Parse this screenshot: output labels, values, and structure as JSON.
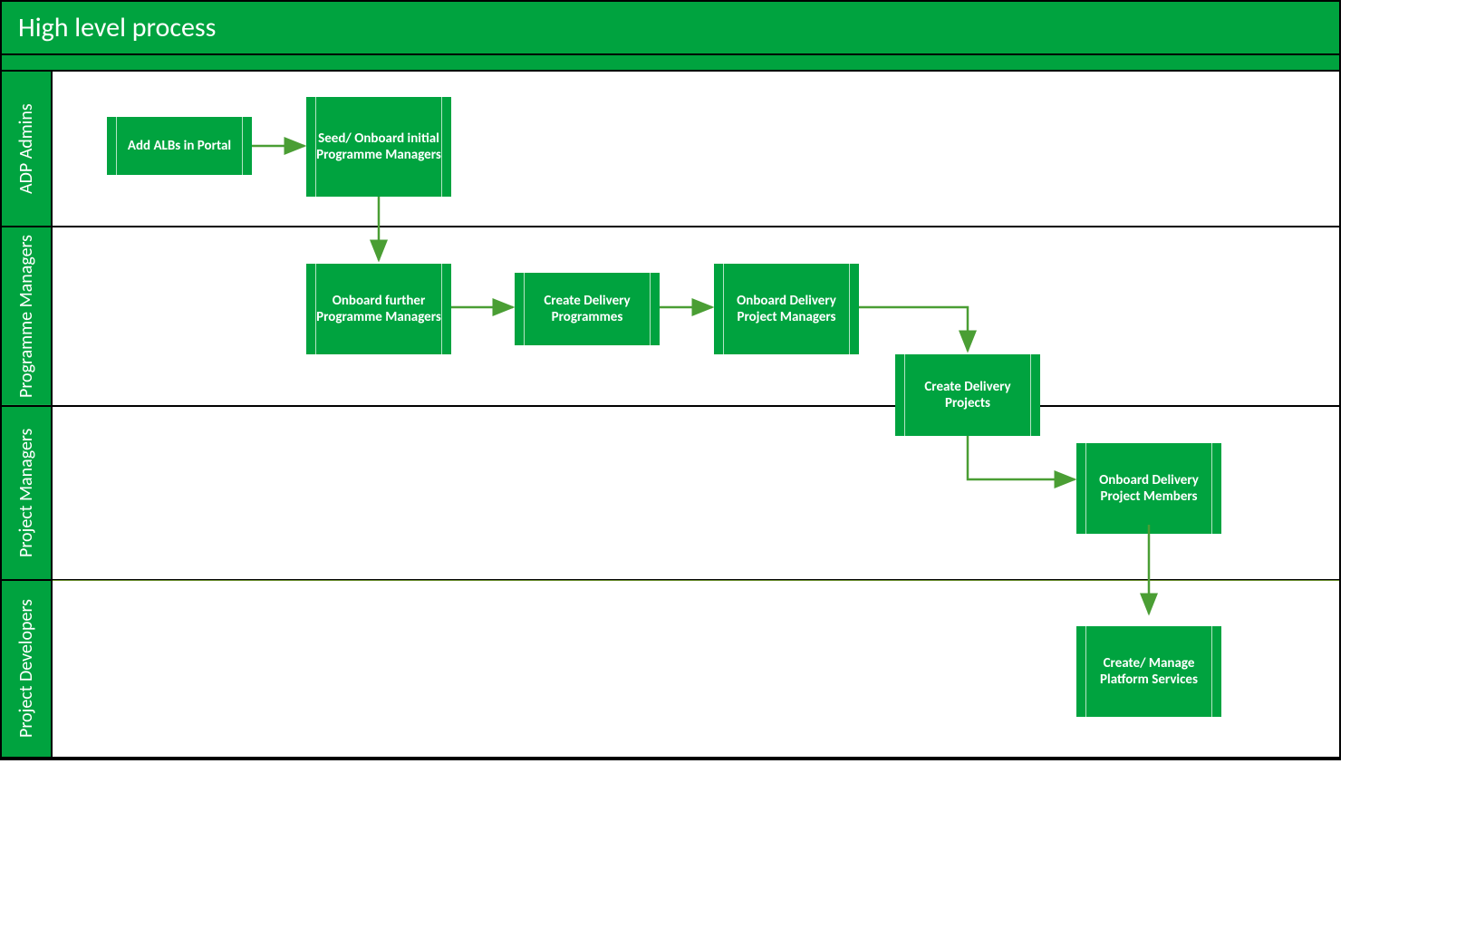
{
  "title": "High level process",
  "colors": {
    "brand": "#00A33F",
    "arrow": "#4a9e34"
  },
  "lanes": [
    {
      "id": "adp-admins",
      "label": "ADP Admins"
    },
    {
      "id": "programme-managers",
      "label": "Programme Managers"
    },
    {
      "id": "project-managers",
      "label": "Project Managers"
    },
    {
      "id": "project-developers",
      "label": "Project Developers"
    }
  ],
  "nodes": {
    "add_albs": {
      "label": "Add ALBs in Portal",
      "lane": "adp-admins"
    },
    "seed_onboard": {
      "label": "Seed/ Onboard initial Programme Managers",
      "lane": "adp-admins"
    },
    "onboard_further_pm": {
      "label": "Onboard further Programme Managers",
      "lane": "programme-managers"
    },
    "create_programmes": {
      "label": "Create Delivery Programmes",
      "lane": "programme-managers"
    },
    "onboard_delivery_pm": {
      "label": "Onboard Delivery Project Managers",
      "lane": "programme-managers"
    },
    "create_projects": {
      "label": "Create Delivery Projects",
      "lane": "programme-managers/project-managers"
    },
    "onboard_members": {
      "label": "Onboard Delivery Project Members",
      "lane": "project-managers"
    },
    "create_services": {
      "label": "Create/ Manage Platform Services",
      "lane": "project-developers"
    }
  },
  "edges": [
    {
      "from": "add_albs",
      "to": "seed_onboard"
    },
    {
      "from": "seed_onboard",
      "to": "onboard_further_pm"
    },
    {
      "from": "onboard_further_pm",
      "to": "create_programmes"
    },
    {
      "from": "create_programmes",
      "to": "onboard_delivery_pm"
    },
    {
      "from": "onboard_delivery_pm",
      "to": "create_projects"
    },
    {
      "from": "create_projects",
      "to": "onboard_members"
    },
    {
      "from": "onboard_members",
      "to": "create_services"
    }
  ]
}
